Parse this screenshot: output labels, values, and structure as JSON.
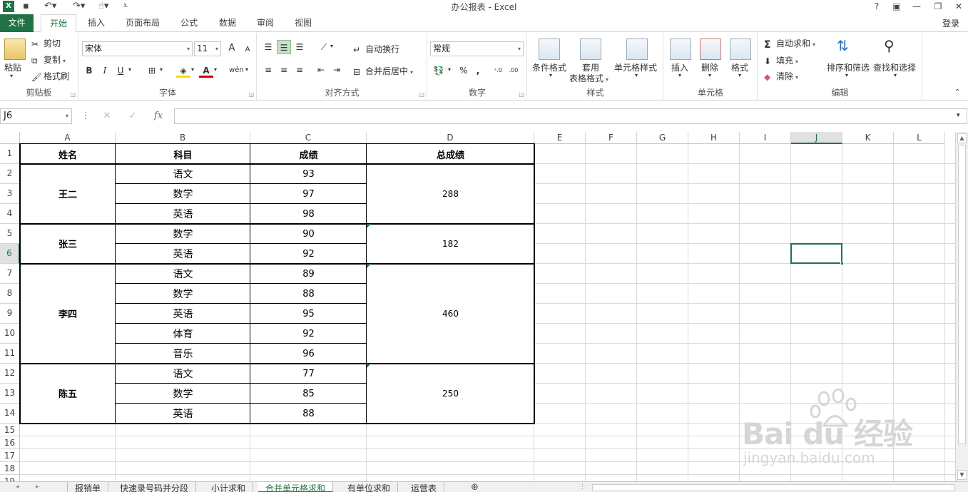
{
  "window": {
    "title": "办公报表 - Excel",
    "controls": [
      "?",
      "▣",
      "—",
      "❐",
      "✕"
    ]
  },
  "tabs": {
    "file": "文件",
    "items": [
      "开始",
      "插入",
      "页面布局",
      "公式",
      "数据",
      "审阅",
      "视图"
    ],
    "active_index": 0,
    "login": "登录"
  },
  "ribbon": {
    "clipboard": {
      "label": "剪贴板",
      "paste": "粘贴",
      "cut": "剪切",
      "copy": "复制",
      "format_painter": "格式刷"
    },
    "font": {
      "label": "字体",
      "font_name": "宋体",
      "font_size": "11",
      "bold": "B",
      "italic": "I",
      "underline": "U",
      "grow": "A",
      "shrink": "A"
    },
    "alignment": {
      "label": "对齐方式",
      "wrap": "自动换行",
      "merge": "合并后居中"
    },
    "number": {
      "label": "数字",
      "format": "常规",
      "percent": "%",
      "comma": ","
    },
    "styles": {
      "label": "样式",
      "conditional": "条件格式",
      "table_format_1": "套用",
      "table_format_2": "表格格式",
      "cell_style": "单元格样式"
    },
    "cells": {
      "label": "单元格",
      "insert": "插入",
      "delete": "删除",
      "format": "格式"
    },
    "editing": {
      "label": "编辑",
      "autosum": "自动求和",
      "fill": "填充",
      "clear": "清除",
      "sort": "排序和筛选",
      "find": "查找和选择"
    }
  },
  "formula_bar": {
    "name_box": "J6",
    "cancel": "✕",
    "enter": "✓",
    "fx": "fx",
    "value": ""
  },
  "grid": {
    "columns": [
      "A",
      "B",
      "C",
      "D",
      "E",
      "F",
      "G",
      "H",
      "I",
      "J",
      "K",
      "L"
    ],
    "rows": [
      "1",
      "2",
      "3",
      "4",
      "5",
      "6",
      "7",
      "8",
      "9",
      "10",
      "11",
      "12",
      "13",
      "14",
      "15",
      "16",
      "17",
      "18",
      "19"
    ],
    "selected_column": "J",
    "selected_row": "6",
    "headers": {
      "name": "姓名",
      "subject": "科目",
      "score": "成绩",
      "total": "总成绩"
    },
    "students": [
      {
        "name": "王二",
        "total": "288",
        "rows": [
          [
            "语文",
            "93"
          ],
          [
            "数学",
            "97"
          ],
          [
            "英语",
            "98"
          ]
        ]
      },
      {
        "name": "张三",
        "total": "182",
        "rows": [
          [
            "数学",
            "90"
          ],
          [
            "英语",
            "92"
          ]
        ]
      },
      {
        "name": "李四",
        "total": "460",
        "rows": [
          [
            "语文",
            "89"
          ],
          [
            "数学",
            "88"
          ],
          [
            "英语",
            "95"
          ],
          [
            "体育",
            "92"
          ],
          [
            "音乐",
            "96"
          ]
        ]
      },
      {
        "name": "陈五",
        "total": "250",
        "rows": [
          [
            "语文",
            "77"
          ],
          [
            "数学",
            "85"
          ],
          [
            "英语",
            "88"
          ]
        ]
      }
    ]
  },
  "sheets": {
    "tabs": [
      "报销单",
      "快速录号码并分段",
      "小计求和",
      "合并单元格求和",
      "有单位求和",
      "运营表"
    ],
    "active_index": 3,
    "add": "⊕"
  },
  "watermark": {
    "brand": "Bai du 经验",
    "url": "jingyan.baidu.com"
  },
  "colors": {
    "accent": "#217346",
    "grid_line": "#dadada",
    "border": "#000000"
  }
}
